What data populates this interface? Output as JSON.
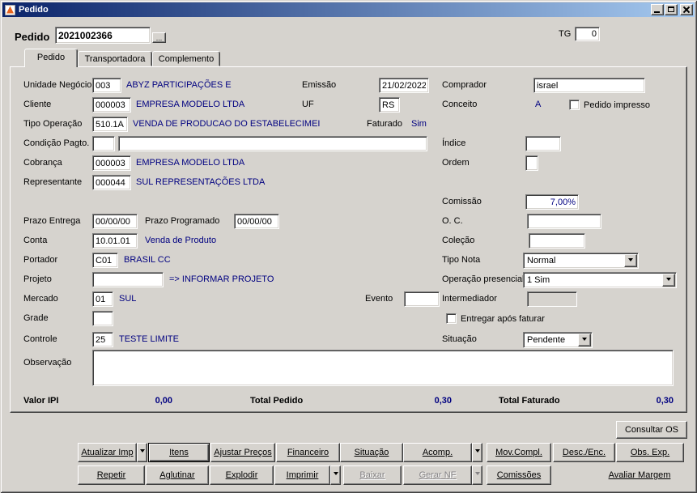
{
  "window": {
    "title": "Pedido"
  },
  "header": {
    "pedido_label": "Pedido",
    "pedido_value": "2021002366",
    "lookup_label": "...",
    "tg_label": "TG",
    "tg_value": "0"
  },
  "tabs": {
    "pedido": "Pedido",
    "transportadora": "Transportadora",
    "complemento": "Complemento"
  },
  "form": {
    "unidade_negocio": {
      "label": "Unidade Negócio",
      "code": "003",
      "desc": "ABYZ PARTICIPAÇÕES E"
    },
    "emissao": {
      "label": "Emissão",
      "value": "21/02/2022"
    },
    "comprador": {
      "label": "Comprador",
      "value": "israel"
    },
    "cliente": {
      "label": "Cliente",
      "code": "000003",
      "desc": "EMPRESA MODELO LTDA"
    },
    "uf": {
      "label": "UF",
      "value": "RS"
    },
    "conceito": {
      "label": "Conceito",
      "value": "A"
    },
    "pedido_impresso": {
      "label": "Pedido impresso",
      "checked": false
    },
    "tipo_operacao": {
      "label": "Tipo Operação",
      "code": "510.1A",
      "desc": "VENDA DE PRODUCAO DO ESTABELECIMEI"
    },
    "faturado": {
      "label": "Faturado",
      "value": "Sim"
    },
    "condicao_pagto": {
      "label": "Condição Pagto.",
      "code": "",
      "desc": ""
    },
    "indice": {
      "label": "Índice",
      "value": ""
    },
    "cobranca": {
      "label": "Cobrança",
      "code": "000003",
      "desc": "EMPRESA MODELO LTDA"
    },
    "ordem": {
      "label": "Ordem",
      "value": ""
    },
    "representante": {
      "label": "Representante",
      "code": "000044",
      "desc": "SUL REPRESENTAÇÕES LTDA"
    },
    "comissao": {
      "label": "Comissão",
      "value": "7,00%"
    },
    "prazo_entrega": {
      "label": "Prazo Entrega",
      "value": "00/00/00"
    },
    "prazo_programado": {
      "label": "Prazo Programado",
      "value": "00/00/00"
    },
    "oc": {
      "label": "O. C.",
      "value": ""
    },
    "conta": {
      "label": "Conta",
      "code": "10.01.01",
      "desc": "Venda de Produto"
    },
    "colecao": {
      "label": "Coleção",
      "value": ""
    },
    "portador": {
      "label": "Portador",
      "code": "C01",
      "desc": "BRASIL CC"
    },
    "tipo_nota": {
      "label": "Tipo Nota",
      "value": "Normal"
    },
    "projeto": {
      "label": "Projeto",
      "code": "",
      "desc": "=> INFORMAR PROJETO"
    },
    "operacao_presencial": {
      "label": "Operação presencial",
      "value": "1 Sim"
    },
    "mercado": {
      "label": "Mercado",
      "code": "01",
      "desc": "SUL"
    },
    "evento": {
      "label": "Evento",
      "value": ""
    },
    "intermediador": {
      "label": "Intermediador",
      "value": ""
    },
    "grade": {
      "label": "Grade",
      "value": ""
    },
    "entregar_apos_faturar": {
      "label": "Entregar após faturar",
      "checked": false
    },
    "controle": {
      "label": "Controle",
      "code": "25",
      "desc": "TESTE LIMITE"
    },
    "situacao": {
      "label": "Situação",
      "value": "Pendente"
    },
    "observacao": {
      "label": "Observação",
      "value": ""
    }
  },
  "totals": {
    "valor_ipi_label": "Valor IPI",
    "valor_ipi": "0,00",
    "total_pedido_label": "Total Pedido",
    "total_pedido": "0,30",
    "total_faturado_label": "Total Faturado",
    "total_faturado": "0,30"
  },
  "actions": {
    "consultar_os": "Consultar OS",
    "atualizar_imp": "Atualizar Imp",
    "itens": "Itens",
    "ajustar_precos": "Ajustar Preços",
    "financeiro": "Financeiro",
    "situacao": "Situação",
    "acomp": "Acomp.",
    "mov_compl": "Mov.Compl.",
    "desc_enc": "Desc./Enc.",
    "obs_exp": "Obs. Exp.",
    "repetir": "Repetir",
    "aglutinar": "Aglutinar",
    "explodir": "Explodir",
    "imprimir": "Imprimir",
    "baixar": "Baixar",
    "gerar_nf": "Gerar NF",
    "comissoes": "Comissões",
    "avaliar_margem": "Avaliar Margem"
  },
  "colors": {
    "navy": "#000080",
    "titlebar_left": "#0b246a",
    "titlebar_right": "#a6caf0",
    "face": "#d6d3ce"
  }
}
